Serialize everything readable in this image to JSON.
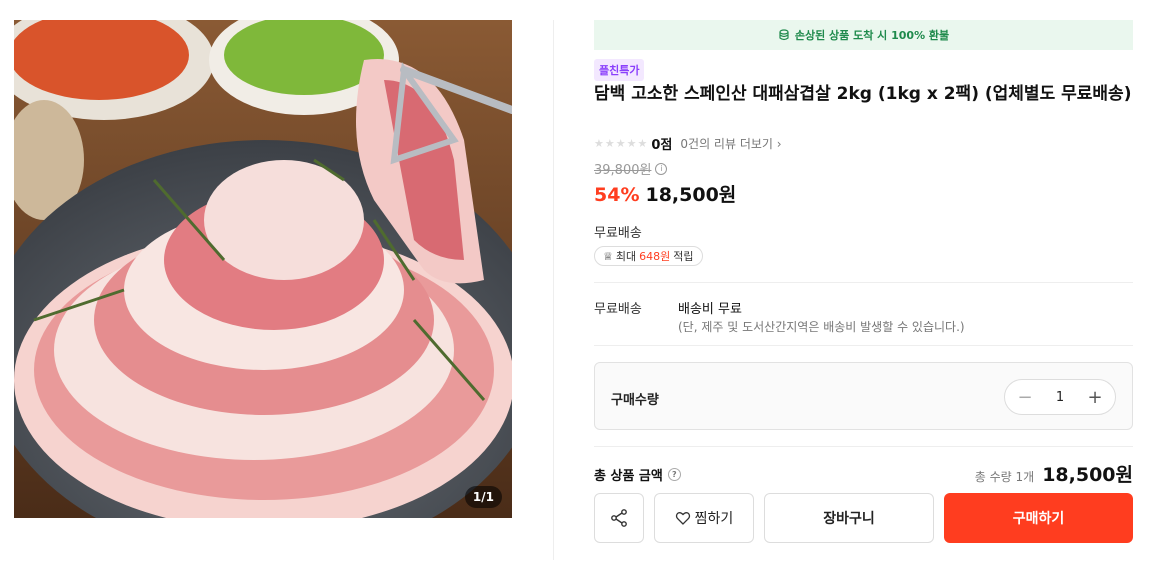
{
  "image": {
    "counter": "1/1"
  },
  "refund_banner": {
    "text": "손상된 상품 도착 시 100% 환불",
    "color": "#1f8a4c"
  },
  "product": {
    "promo_tag": "플친특가",
    "title": "담백 고소한 스페인산 대패삼겹살 2kg (1kg x 2팩) (업체별도 무료배송)",
    "rating_score": "0점",
    "review_link": "0건의 리뷰 더보기",
    "original_price": "39,800원",
    "discount": "54%",
    "sale_price": "18,500원"
  },
  "shipping": {
    "label": "무료배송",
    "points_prefix": "최대",
    "points_amount": "648원",
    "points_suffix": "적립",
    "row_label": "무료배송",
    "fee": "배송비 무료",
    "note": "(단, 제주 및 도서산간지역은 배송비 발생할 수 있습니다.)"
  },
  "quantity": {
    "label": "구매수량",
    "value": "1"
  },
  "total": {
    "label": "총 상품 금액",
    "qty_text": "총 수량 1개",
    "price": "18,500원"
  },
  "actions": {
    "share_icon": "share-icon",
    "wish_label": "찜하기",
    "cart_label": "장바구니",
    "buy_label": "구매하기"
  },
  "colors": {
    "accent": "#ff3d1f",
    "promo": "#8a3ffc",
    "banner_bg": "#eaf7ee"
  }
}
